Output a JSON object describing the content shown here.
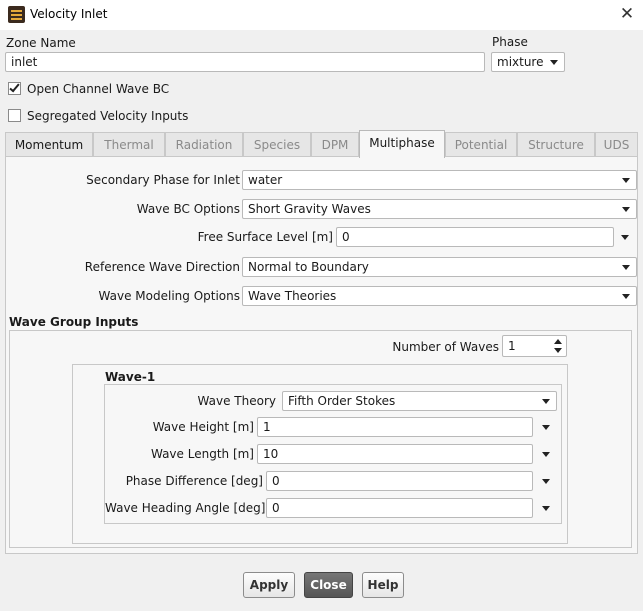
{
  "window": {
    "title": "Velocity Inlet",
    "close_glyph": "✕"
  },
  "zone": {
    "label": "Zone Name",
    "value": "inlet"
  },
  "phase": {
    "label": "Phase",
    "value": "mixture"
  },
  "options": {
    "open_channel": {
      "label": "Open Channel Wave BC",
      "checked": true
    },
    "segregated": {
      "label": "Segregated Velocity Inputs",
      "checked": false
    }
  },
  "tabs": [
    {
      "label": "Momentum",
      "enabled": true
    },
    {
      "label": "Thermal",
      "enabled": false
    },
    {
      "label": "Radiation",
      "enabled": false
    },
    {
      "label": "Species",
      "enabled": false
    },
    {
      "label": "DPM",
      "enabled": false
    },
    {
      "label": "Multiphase",
      "enabled": true,
      "active": true
    },
    {
      "label": "Potential",
      "enabled": false
    },
    {
      "label": "Structure",
      "enabled": false
    },
    {
      "label": "UDS",
      "enabled": false
    }
  ],
  "multiphase": {
    "secondary_phase": {
      "label": "Secondary Phase for Inlet",
      "value": "water"
    },
    "wave_bc_options": {
      "label": "Wave BC Options",
      "value": "Short Gravity Waves"
    },
    "free_surface_level": {
      "label": "Free Surface Level [m]",
      "value": "0"
    },
    "reference_wave_direction": {
      "label": "Reference Wave Direction",
      "value": "Normal to Boundary"
    },
    "wave_modeling_options": {
      "label": "Wave Modeling Options",
      "value": "Wave Theories"
    }
  },
  "wave_group": {
    "title": "Wave Group Inputs",
    "number_of_waves": {
      "label": "Number of Waves",
      "value": "1"
    },
    "wave1": {
      "title": "Wave-1",
      "wave_theory": {
        "label": "Wave Theory",
        "value": "Fifth Order Stokes"
      },
      "wave_height": {
        "label": "Wave Height [m]",
        "value": "1"
      },
      "wave_length": {
        "label": "Wave Length [m]",
        "value": "10"
      },
      "phase_difference": {
        "label": "Phase Difference [deg]",
        "value": "0"
      },
      "wave_heading_angle": {
        "label": "Wave Heading Angle [deg]",
        "value": "0"
      }
    }
  },
  "buttons": {
    "apply": "Apply",
    "close": "Close",
    "help": "Help"
  },
  "colors": {
    "background": "#f0f0f0",
    "panel": "#f7f7f7",
    "active_button": "#5f5f5f",
    "disabled_text": "#8a8a8a"
  },
  "icons": {
    "app": "fluent-app-icon",
    "close": "close-icon",
    "dropdown": "chevron-down-icon",
    "check": "check-icon"
  }
}
